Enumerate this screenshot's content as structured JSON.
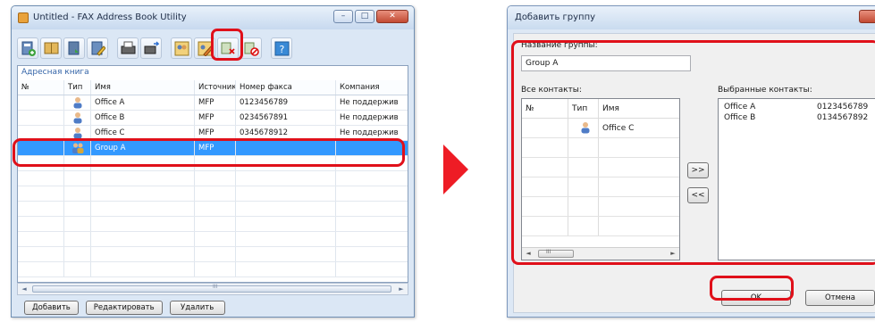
{
  "left_window": {
    "title": "Untitled - FAX Address Book Utility",
    "controls": {
      "minimize": "–",
      "maximize": "□",
      "close": "✕"
    },
    "toolbar": [
      {
        "name": "add-contact-icon"
      },
      {
        "name": "address-book-icon"
      },
      {
        "name": "import-icon"
      },
      {
        "name": "edit-book-icon"
      },
      {
        "name": "fax-machine-icon"
      },
      {
        "name": "fax-send-icon"
      },
      {
        "name": "add-group-icon"
      },
      {
        "name": "edit-group-icon"
      },
      {
        "name": "delete-entry-icon"
      },
      {
        "name": "block-entry-icon"
      },
      {
        "name": "help-icon"
      }
    ],
    "panel_caption": "Адресная книга",
    "columns": {
      "num": "№",
      "type": "Тип",
      "name": "Имя",
      "source": "Источник",
      "fax": "Номер факса",
      "company": "Компания"
    },
    "rows": [
      {
        "num": "",
        "type": "contact",
        "name": "Office A",
        "source": "MFP",
        "fax": "0123456789",
        "company": "Не поддержив"
      },
      {
        "num": "",
        "type": "contact",
        "name": "Office B",
        "source": "MFP",
        "fax": "0234567891",
        "company": "Не поддержив"
      },
      {
        "num": "",
        "type": "contact",
        "name": "Office C",
        "source": "MFP",
        "fax": "0345678912",
        "company": "Не поддержив"
      },
      {
        "num": "",
        "type": "group",
        "name": "Group A",
        "source": "MFP",
        "fax": "",
        "company": ""
      }
    ],
    "empty_rows": 8,
    "scroll_grip": "III",
    "buttons": {
      "add": "Добавить",
      "edit": "Редактировать",
      "delete": "Удалить"
    }
  },
  "dialog": {
    "title": "Добавить группу",
    "group_name_label": "Название группы:",
    "group_name_value": "Group A",
    "all_contacts_label": "Все контакты:",
    "selected_contacts_label": "Выбранные контакты:",
    "columns": {
      "num": "№",
      "type": "Тип",
      "name": "Имя"
    },
    "all_contacts": [
      {
        "num": "",
        "type": "contact",
        "name": "Office C"
      }
    ],
    "empty_rows": 5,
    "scroll_grip": "III",
    "move_right": ">>",
    "move_left": "<<",
    "selected_contacts": [
      {
        "name": "Office A",
        "fax": "0123456789"
      },
      {
        "name": "Office B",
        "fax": "0134567892"
      }
    ],
    "ok": "OK",
    "cancel": "Отмена"
  },
  "colors": {
    "highlight": "#e0101a",
    "arrow": "#ee1c25",
    "selection": "#3399ff"
  }
}
